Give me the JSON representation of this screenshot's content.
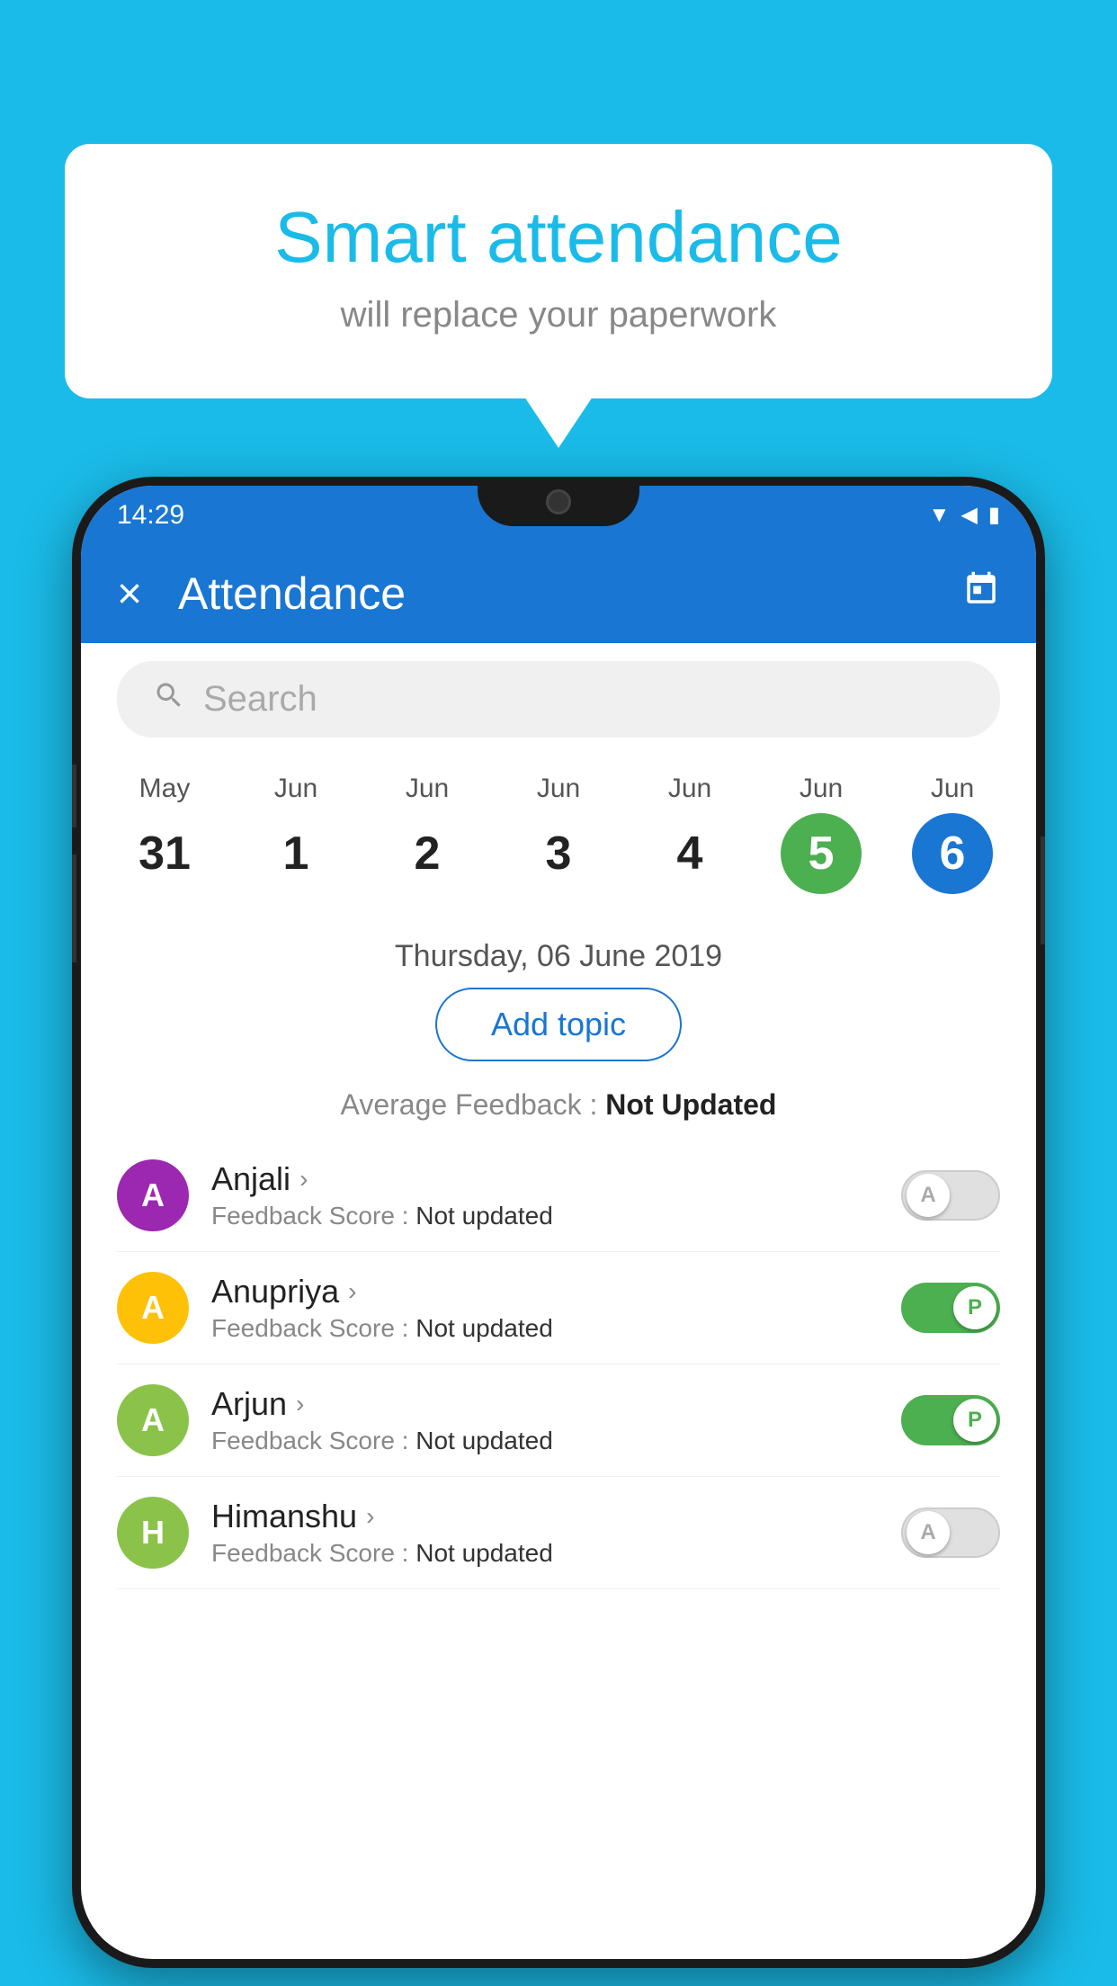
{
  "background": {
    "color": "#1ABBE8"
  },
  "speech_bubble": {
    "title": "Smart attendance",
    "subtitle": "will replace your paperwork"
  },
  "phone": {
    "status_bar": {
      "time": "14:29",
      "icons": "▼◀▮"
    },
    "app_bar": {
      "close_label": "×",
      "title": "Attendance",
      "calendar_icon": "📅"
    },
    "search": {
      "placeholder": "Search"
    },
    "calendar": {
      "days": [
        {
          "month": "May",
          "date": "31",
          "state": "normal"
        },
        {
          "month": "Jun",
          "date": "1",
          "state": "normal"
        },
        {
          "month": "Jun",
          "date": "2",
          "state": "normal"
        },
        {
          "month": "Jun",
          "date": "3",
          "state": "normal"
        },
        {
          "month": "Jun",
          "date": "4",
          "state": "normal"
        },
        {
          "month": "Jun",
          "date": "5",
          "state": "today"
        },
        {
          "month": "Jun",
          "date": "6",
          "state": "selected"
        }
      ]
    },
    "selected_date": "Thursday, 06 June 2019",
    "add_topic_label": "Add topic",
    "avg_feedback_label": "Average Feedback :",
    "avg_feedback_value": "Not Updated",
    "students": [
      {
        "name": "Anjali",
        "avatar_letter": "A",
        "avatar_color": "#9C27B0",
        "feedback_label": "Feedback Score :",
        "feedback_value": "Not updated",
        "toggle_state": "off",
        "toggle_letter": "A"
      },
      {
        "name": "Anupriya",
        "avatar_letter": "A",
        "avatar_color": "#FFC107",
        "feedback_label": "Feedback Score :",
        "feedback_value": "Not updated",
        "toggle_state": "on",
        "toggle_letter": "P"
      },
      {
        "name": "Arjun",
        "avatar_letter": "A",
        "avatar_color": "#8BC34A",
        "feedback_label": "Feedback Score :",
        "feedback_value": "Not updated",
        "toggle_state": "on",
        "toggle_letter": "P"
      },
      {
        "name": "Himanshu",
        "avatar_letter": "H",
        "avatar_color": "#8BC34A",
        "feedback_label": "Feedback Score :",
        "feedback_value": "Not updated",
        "toggle_state": "off",
        "toggle_letter": "A"
      }
    ]
  }
}
